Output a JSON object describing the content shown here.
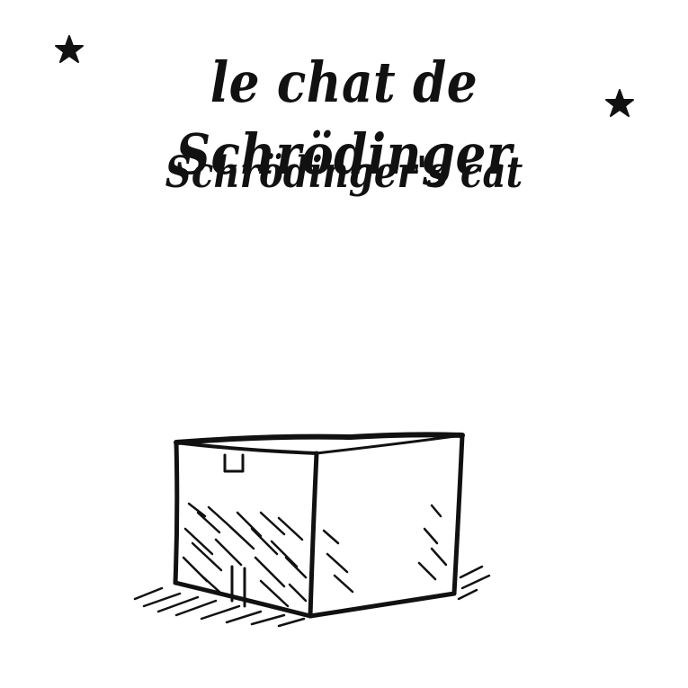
{
  "title": "le chat de Schrödinger",
  "subtitle": "Schrödinger's cat",
  "ink_color": "#111111",
  "background_color": "#ffffff",
  "icons": {
    "left": "star-icon",
    "right": "star-icon",
    "illustration": "cardboard-box-icon"
  }
}
